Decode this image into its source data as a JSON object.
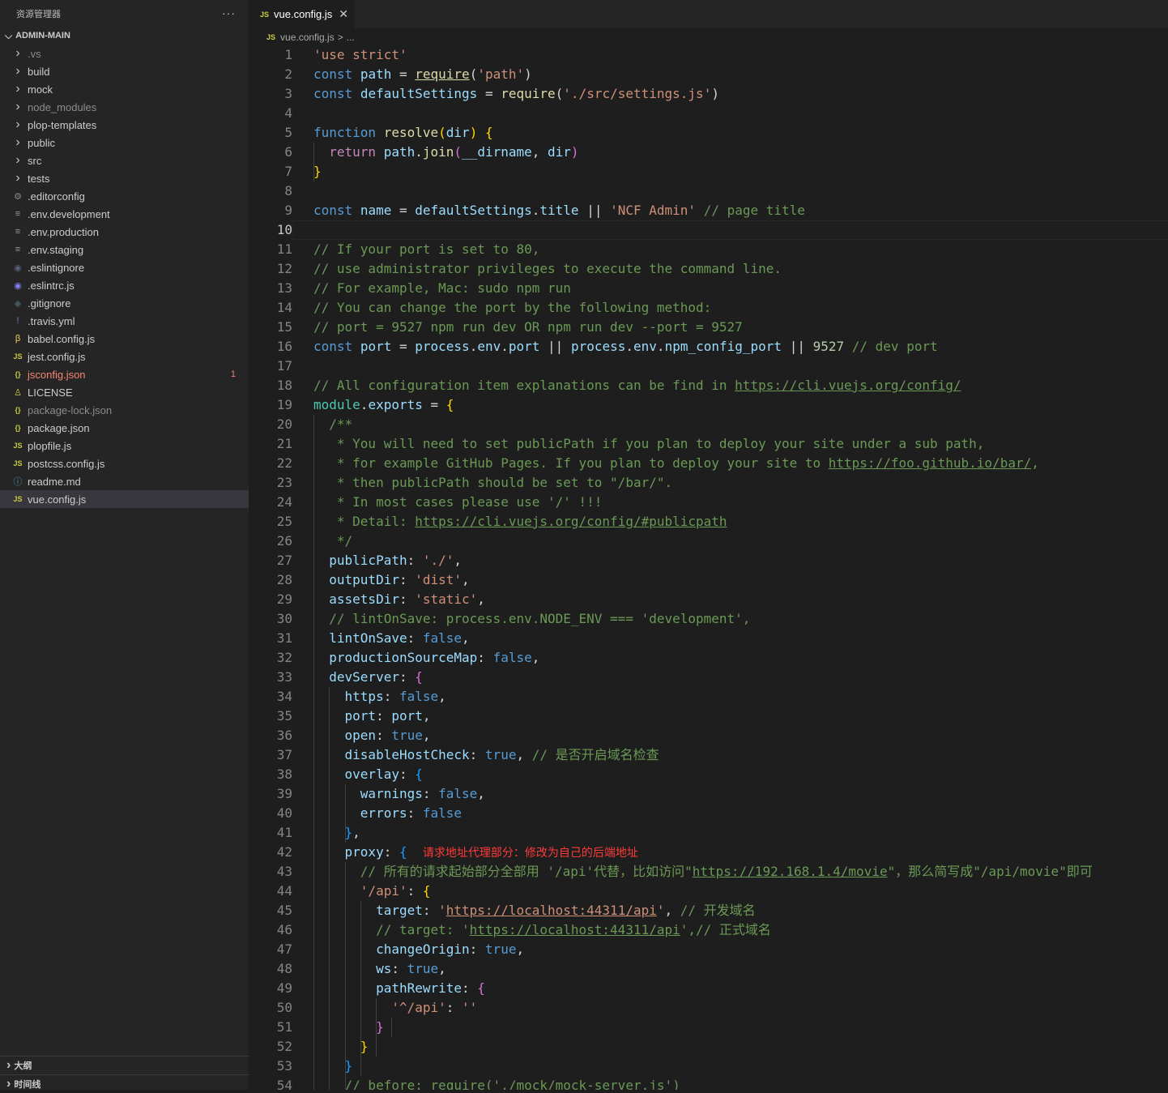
{
  "sidebar": {
    "title": "资源管理器",
    "more": "···",
    "root": "ADMIN-MAIN",
    "items": [
      {
        "label": ".vs",
        "icon": "chevron-right-icon",
        "dim": true
      },
      {
        "label": "build",
        "icon": "chevron-right-icon"
      },
      {
        "label": "mock",
        "icon": "chevron-right-icon"
      },
      {
        "label": "node_modules",
        "icon": "chevron-right-icon",
        "dim": true
      },
      {
        "label": "plop-templates",
        "icon": "chevron-right-icon"
      },
      {
        "label": "public",
        "icon": "chevron-right-icon"
      },
      {
        "label": "src",
        "icon": "chevron-right-icon"
      },
      {
        "label": "tests",
        "icon": "chevron-right-icon"
      },
      {
        "label": ".editorconfig",
        "icon": "gear-icon"
      },
      {
        "label": ".env.development",
        "icon": "lines-icon"
      },
      {
        "label": ".env.production",
        "icon": "lines-icon"
      },
      {
        "label": ".env.staging",
        "icon": "lines-icon"
      },
      {
        "label": ".eslintignore",
        "icon": "eslint-dim-icon"
      },
      {
        "label": ".eslintrc.js",
        "icon": "eslint-icon"
      },
      {
        "label": ".gitignore",
        "icon": "git-icon"
      },
      {
        "label": ".travis.yml",
        "icon": "exclamation-icon"
      },
      {
        "label": "babel.config.js",
        "icon": "babel-icon"
      },
      {
        "label": "jest.config.js",
        "icon": "js-icon"
      },
      {
        "label": "jsconfig.json",
        "icon": "json-icon",
        "error": true,
        "badge": "1"
      },
      {
        "label": "LICENSE",
        "icon": "license-icon"
      },
      {
        "label": "package-lock.json",
        "icon": "json-icon",
        "dim": true
      },
      {
        "label": "package.json",
        "icon": "json-icon"
      },
      {
        "label": "plopfile.js",
        "icon": "js-icon"
      },
      {
        "label": "postcss.config.js",
        "icon": "js-icon"
      },
      {
        "label": "readme.md",
        "icon": "info-icon"
      },
      {
        "label": "vue.config.js",
        "icon": "js-icon",
        "active": true
      }
    ],
    "panels": [
      "大纲",
      "时间线"
    ]
  },
  "tab": {
    "label": "vue.config.js",
    "close": "✕",
    "icon_text": "JS"
  },
  "breadcrumb": {
    "file": "vue.config.js",
    "sep": ">",
    "rest": "..."
  },
  "editor": {
    "current_line": 10,
    "lines": [
      {
        "ln": "1",
        "code": "<span class=\"s\">'use strict'</span>"
      },
      {
        "ln": "2",
        "code": "<span class=\"k\">const</span> <span class=\"v\">path</span> = <span class=\"f u\">require</span>(<span class=\"s\">'path'</span>)"
      },
      {
        "ln": "3",
        "code": "<span class=\"k\">const</span> <span class=\"v\">defaultSettings</span> = <span class=\"f\">require</span>(<span class=\"s\">'./src/settings.js'</span>)"
      },
      {
        "ln": "4",
        "code": ""
      },
      {
        "ln": "5",
        "code": "<span class=\"k\">function</span> <span class=\"f\">resolve</span><span class=\"y\">(</span><span class=\"v\">dir</span><span class=\"y\">)</span> <span class=\"y\">{</span>"
      },
      {
        "ln": "6",
        "code": "  <span class=\"p\">return</span> <span class=\"v\">path</span>.<span class=\"f\">join</span><span class=\"b2\">(</span><span class=\"v\">__dirname</span>, <span class=\"v\">dir</span><span class=\"b2\">)</span>"
      },
      {
        "ln": "7",
        "code": "<span class=\"y\">}</span>"
      },
      {
        "ln": "8",
        "code": ""
      },
      {
        "ln": "9",
        "code": "<span class=\"k\">const</span> <span class=\"v\">name</span> = <span class=\"v\">defaultSettings</span>.<span class=\"v\">title</span> || <span class=\"s\">'NCF Admin'</span> <span class=\"c\">// page title</span>"
      },
      {
        "ln": "10",
        "code": ""
      },
      {
        "ln": "11",
        "code": "<span class=\"c\">// If your port is set to 80,</span>"
      },
      {
        "ln": "12",
        "code": "<span class=\"c\">// use administrator privileges to execute the command line.</span>"
      },
      {
        "ln": "13",
        "code": "<span class=\"c\">// For example, Mac: sudo npm run</span>"
      },
      {
        "ln": "14",
        "code": "<span class=\"c\">// You can change the port by the following method:</span>"
      },
      {
        "ln": "15",
        "code": "<span class=\"c\">// port = 9527 npm run dev OR npm run dev --port = 9527</span>"
      },
      {
        "ln": "16",
        "code": "<span class=\"k\">const</span> <span class=\"v\">port</span> = <span class=\"v\">process</span>.<span class=\"v\">env</span>.<span class=\"v\">port</span> || <span class=\"v\">process</span>.<span class=\"v\">env</span>.<span class=\"v\">npm_config_port</span> || <span class=\"n\">9527</span> <span class=\"c\">// dev port</span>"
      },
      {
        "ln": "17",
        "code": ""
      },
      {
        "ln": "18",
        "code": "<span class=\"c\">// All configuration item explanations can be find in <span class=\"u\">https://cli.vuejs.org/config/</span></span>"
      },
      {
        "ln": "19",
        "code": "<span class=\"t\">module</span>.<span class=\"v\">exports</span> = <span class=\"y\">{</span>"
      },
      {
        "ln": "20",
        "code": "  <span class=\"c\">/**</span>"
      },
      {
        "ln": "21",
        "code": "<span class=\"c\">   * You will need to set publicPath if you plan to deploy your site under a sub path,</span>"
      },
      {
        "ln": "22",
        "code": "<span class=\"c\">   * for example GitHub Pages. If you plan to deploy your site to <span class=\"u\">https://foo.github.io/bar/</span>,</span>"
      },
      {
        "ln": "23",
        "code": "<span class=\"c\">   * then publicPath should be set to \"/bar/\".</span>"
      },
      {
        "ln": "24",
        "code": "<span class=\"c\">   * In most cases please use '/' !!!</span>"
      },
      {
        "ln": "25",
        "code": "<span class=\"c\">   * Detail: <span class=\"u\">https://cli.vuejs.org/config/#publicpath</span></span>"
      },
      {
        "ln": "26",
        "code": "<span class=\"c\">   */</span>"
      },
      {
        "ln": "27",
        "code": "  <span class=\"v\">publicPath</span>: <span class=\"s\">'./'</span>,"
      },
      {
        "ln": "28",
        "code": "  <span class=\"v\">outputDir</span>: <span class=\"s\">'dist'</span>,"
      },
      {
        "ln": "29",
        "code": "  <span class=\"v\">assetsDir</span>: <span class=\"s\">'static'</span>,"
      },
      {
        "ln": "30",
        "code": "  <span class=\"c\">// lintOnSave: process.env.NODE_ENV === 'development',</span>"
      },
      {
        "ln": "31",
        "code": "  <span class=\"v\">lintOnSave</span>: <span class=\"k\">false</span>,"
      },
      {
        "ln": "32",
        "code": "  <span class=\"v\">productionSourceMap</span>: <span class=\"k\">false</span>,"
      },
      {
        "ln": "33",
        "code": "  <span class=\"v\">devServer</span>: <span class=\"b2\">{</span>"
      },
      {
        "ln": "34",
        "code": "    <span class=\"v\">https</span>: <span class=\"k\">false</span>,"
      },
      {
        "ln": "35",
        "code": "    <span class=\"v\">port</span>: <span class=\"v\">port</span>,"
      },
      {
        "ln": "36",
        "code": "    <span class=\"v\">open</span>: <span class=\"k\">true</span>,"
      },
      {
        "ln": "37",
        "code": "    <span class=\"v\">disableHostCheck</span>: <span class=\"k\">true</span>, <span class=\"c\">// 是否开启域名检查</span>"
      },
      {
        "ln": "38",
        "code": "    <span class=\"v\">overlay</span>: <span class=\"b3\">{</span>"
      },
      {
        "ln": "39",
        "code": "      <span class=\"v\">warnings</span>: <span class=\"k\">false</span>,"
      },
      {
        "ln": "40",
        "code": "      <span class=\"v\">errors</span>: <span class=\"k\">false</span>"
      },
      {
        "ln": "41",
        "code": "    <span class=\"b3\">}</span>,"
      },
      {
        "ln": "42",
        "code": "    <span class=\"v\">proxy</span>: <span class=\"b3\">{</span>  <span class=\"red\">请求地址代理部分：修改为自己的后端地址</span>"
      },
      {
        "ln": "43",
        "code": "<span class=\"c\">      // 所有的请求起始部分全部用 '/api'代替，比如访问\"<span class=\"u\">https://192.168.1.4/movie</span>\"，那么简写成\"/api/movie\"即可</span>"
      },
      {
        "ln": "44",
        "code": "      <span class=\"s\">'/api'</span>: <span class=\"y\">{</span>"
      },
      {
        "ln": "45",
        "code": "        <span class=\"v\">target</span>: <span class=\"s\">'<span class=\"u\">https://localhost:44311/api</span>'</span>, <span class=\"c\">// 开发域名</span>"
      },
      {
        "ln": "46",
        "code": "<span class=\"c\">        // target: '<span class=\"u\">https://localhost:44311/api</span>',// 正式域名</span>"
      },
      {
        "ln": "47",
        "code": "        <span class=\"v\">changeOrigin</span>: <span class=\"k\">true</span>,"
      },
      {
        "ln": "48",
        "code": "        <span class=\"v\">ws</span>: <span class=\"k\">true</span>,"
      },
      {
        "ln": "49",
        "code": "        <span class=\"v\">pathRewrite</span>: <span class=\"b2\">{</span>"
      },
      {
        "ln": "50",
        "code": "          <span class=\"s\">'^/api'</span>: <span class=\"s\">''</span>"
      },
      {
        "ln": "51",
        "code": "        <span class=\"b2\">}</span>"
      },
      {
        "ln": "52",
        "code": "      <span class=\"y\">}</span>"
      },
      {
        "ln": "53",
        "code": "    <span class=\"b3\">}</span>"
      },
      {
        "ln": "54",
        "code": "<span class=\"c\">    // before: require('./mock/mock-server.js')</span>"
      }
    ]
  }
}
